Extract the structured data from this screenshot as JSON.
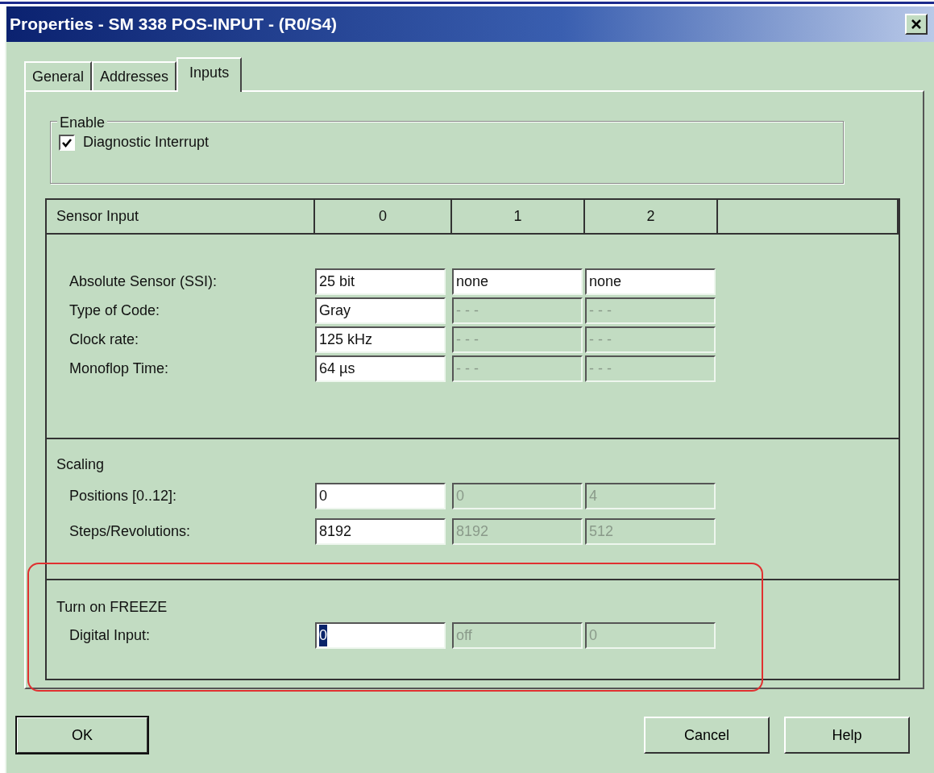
{
  "window": {
    "title": "Properties - SM 338 POS-INPUT - (R0/S4)"
  },
  "tabs": [
    {
      "label": "General",
      "selected": false
    },
    {
      "label": "Addresses",
      "selected": false
    },
    {
      "label": "Inputs",
      "selected": true
    }
  ],
  "enable_group": {
    "title": "Enable",
    "checkbox": {
      "label": "Diagnostic Interrupt",
      "checked": true
    }
  },
  "table": {
    "columns": [
      "Sensor Input",
      "0",
      "1",
      "2"
    ],
    "sections": [
      {
        "rows": [
          {
            "label": "Absolute Sensor (SSI):",
            "fields": [
              {
                "value": "25 bit",
                "enabled": true,
                "focused": false
              },
              {
                "value": "none",
                "enabled": true,
                "focused": false
              },
              {
                "value": "none",
                "enabled": true,
                "focused": false
              }
            ]
          },
          {
            "label": "Type of Code:",
            "fields": [
              {
                "value": "Gray",
                "enabled": true,
                "focused": false
              },
              {
                "value": "- - -",
                "enabled": false,
                "focused": false
              },
              {
                "value": "- - -",
                "enabled": false,
                "focused": false
              }
            ]
          },
          {
            "label": "Clock rate:",
            "fields": [
              {
                "value": "125 kHz",
                "enabled": true,
                "focused": false
              },
              {
                "value": "- - -",
                "enabled": false,
                "focused": false
              },
              {
                "value": "- - -",
                "enabled": false,
                "focused": false
              }
            ]
          },
          {
            "label": "Monoflop Time:",
            "fields": [
              {
                "value": "64 µs",
                "enabled": true,
                "focused": false
              },
              {
                "value": "- - -",
                "enabled": false,
                "focused": false
              },
              {
                "value": "- - -",
                "enabled": false,
                "focused": false
              }
            ]
          }
        ]
      },
      {
        "heading": "Scaling",
        "rows": [
          {
            "label": "Positions  [0..12]:",
            "fields": [
              {
                "value": "0",
                "enabled": true,
                "focused": false
              },
              {
                "value": "0",
                "enabled": false,
                "focused": false
              },
              {
                "value": "4",
                "enabled": false,
                "focused": false
              }
            ]
          },
          {
            "label": "Steps/Revolutions:",
            "fields": [
              {
                "value": "8192",
                "enabled": true,
                "focused": false
              },
              {
                "value": "8192",
                "enabled": false,
                "focused": false
              },
              {
                "value": "512",
                "enabled": false,
                "focused": false
              }
            ]
          }
        ]
      },
      {
        "heading": "Turn on FREEZE",
        "highlighted": true,
        "rows": [
          {
            "label": "Digital Input:",
            "fields": [
              {
                "value": "0",
                "enabled": true,
                "focused": true
              },
              {
                "value": "off",
                "enabled": false,
                "focused": false
              },
              {
                "value": "0",
                "enabled": false,
                "focused": false
              }
            ]
          }
        ]
      }
    ]
  },
  "buttons": [
    {
      "label": "OK",
      "default": true
    },
    {
      "label": "Cancel",
      "default": false
    },
    {
      "label": "Help",
      "default": false
    }
  ]
}
